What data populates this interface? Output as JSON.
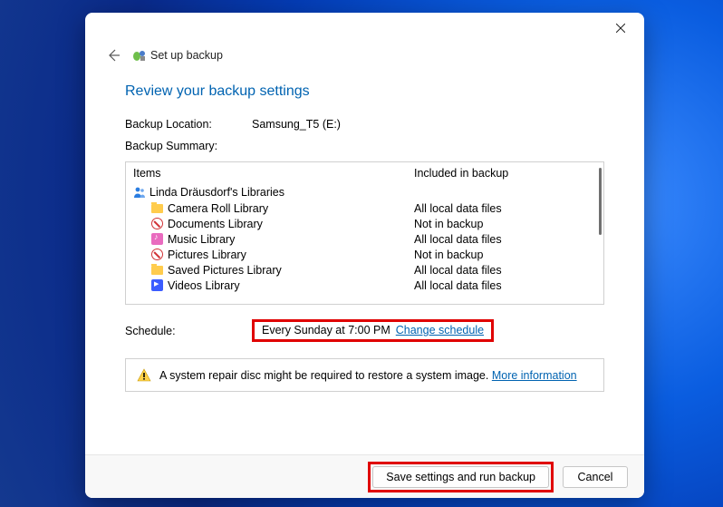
{
  "window": {
    "crumb_title": "Set up backup",
    "heading": "Review your backup settings"
  },
  "location": {
    "label": "Backup Location:",
    "value": "Samsung_T5 (E:)"
  },
  "summary": {
    "label": "Backup Summary:",
    "col_items": "Items",
    "col_included": "Included in backup",
    "root": "Linda Dräusdorf's Libraries",
    "rows": [
      {
        "label": "Camera Roll Library",
        "icon": "folder",
        "included": "All local data files"
      },
      {
        "label": "Documents Library",
        "icon": "no",
        "included": "Not in backup"
      },
      {
        "label": "Music Library",
        "icon": "music",
        "included": "All local data files"
      },
      {
        "label": "Pictures Library",
        "icon": "no",
        "included": "Not in backup"
      },
      {
        "label": "Saved Pictures Library",
        "icon": "folder",
        "included": "All local data files"
      },
      {
        "label": "Videos Library",
        "icon": "video",
        "included": "All local data files"
      }
    ]
  },
  "schedule": {
    "label": "Schedule:",
    "value": "Every Sunday at 7:00 PM",
    "link": "Change schedule"
  },
  "warning": {
    "text": "A system repair disc might be required to restore a system image.",
    "link": "More information"
  },
  "footer": {
    "save_label": "Save settings and run backup",
    "cancel_label": "Cancel"
  }
}
